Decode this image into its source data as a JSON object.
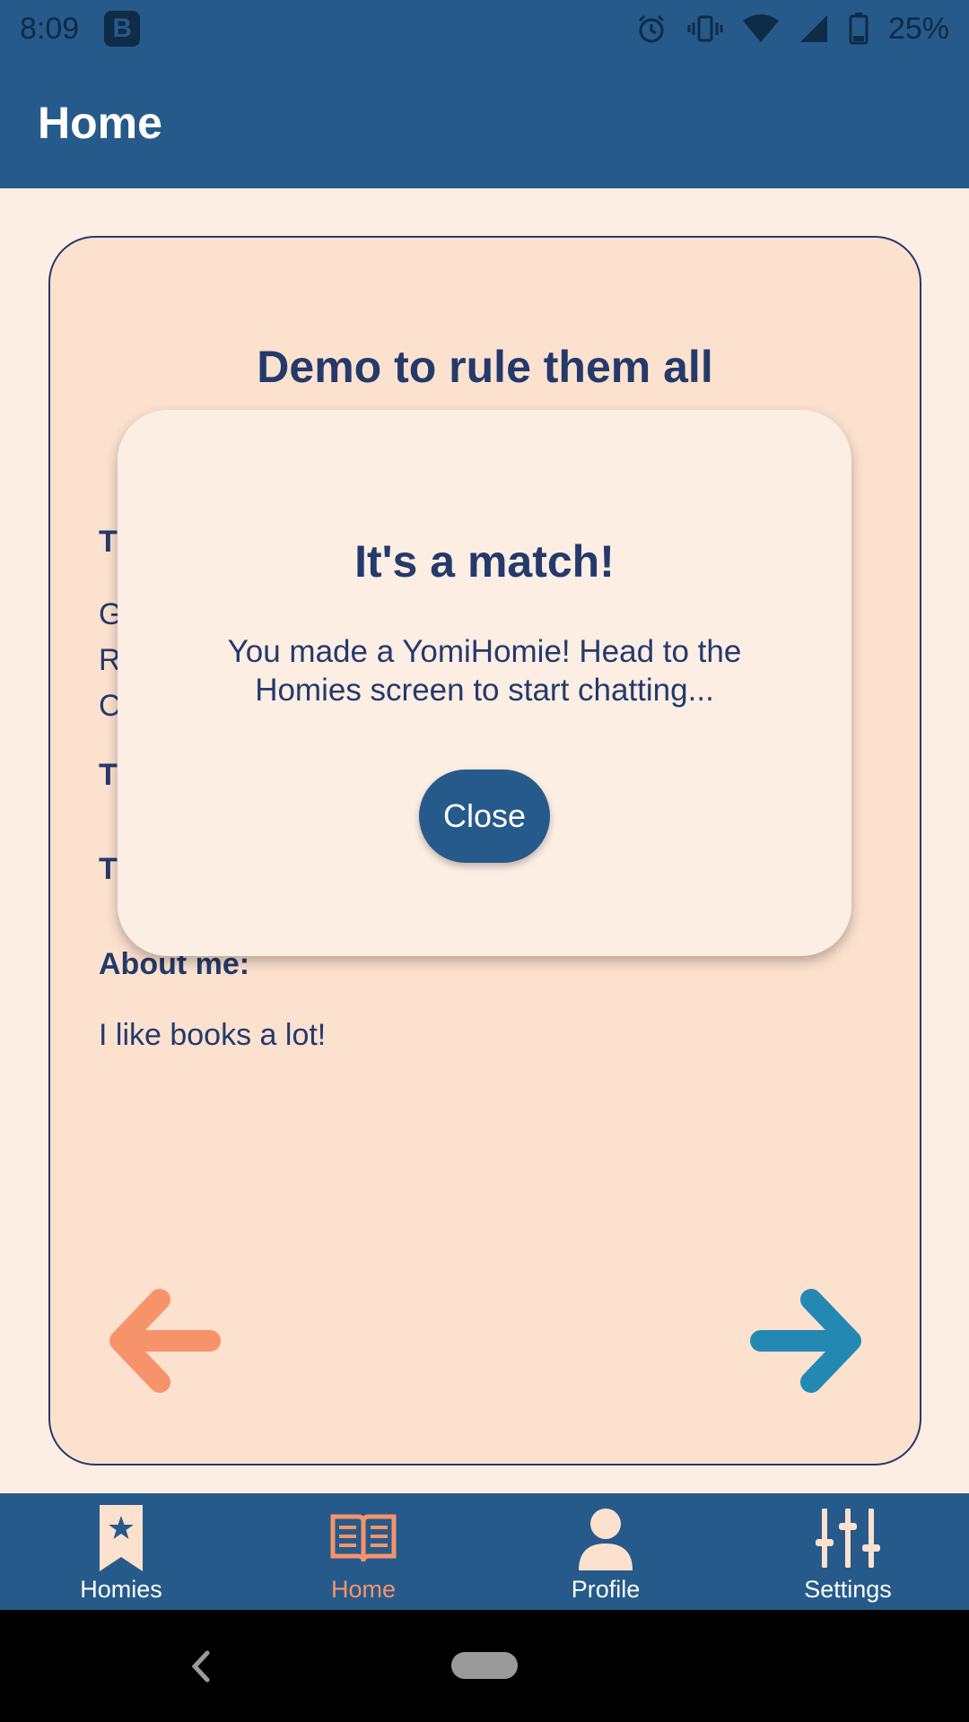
{
  "status_bar": {
    "time": "8:09",
    "app_badge": "B",
    "battery": "25%"
  },
  "app_bar": {
    "title": "Home"
  },
  "card": {
    "title": "Demo to rule them all",
    "partial_label_1": "T",
    "partial_text_lines": [
      "G",
      "R",
      "C"
    ],
    "partial_label_2": "T",
    "partial_label_3": "T",
    "about_label": "About me:",
    "about_text": "I like books a lot!"
  },
  "modal": {
    "title": "It's a match!",
    "message": "You made a YomiHomie! Head to the Homies screen to start chatting...",
    "close_label": "Close"
  },
  "bottom_nav": {
    "items": [
      {
        "label": "Homies",
        "icon": "bookmark-star-icon",
        "active": false
      },
      {
        "label": "Home",
        "icon": "open-book-icon",
        "active": true
      },
      {
        "label": "Profile",
        "icon": "person-icon",
        "active": false
      },
      {
        "label": "Settings",
        "icon": "sliders-icon",
        "active": false
      }
    ]
  },
  "colors": {
    "primary": "#265a8a",
    "background": "#fdeee4",
    "card": "#fde1cf",
    "text": "#243a6b",
    "accent_orange": "#f7936a",
    "accent_teal": "#2389b3"
  }
}
